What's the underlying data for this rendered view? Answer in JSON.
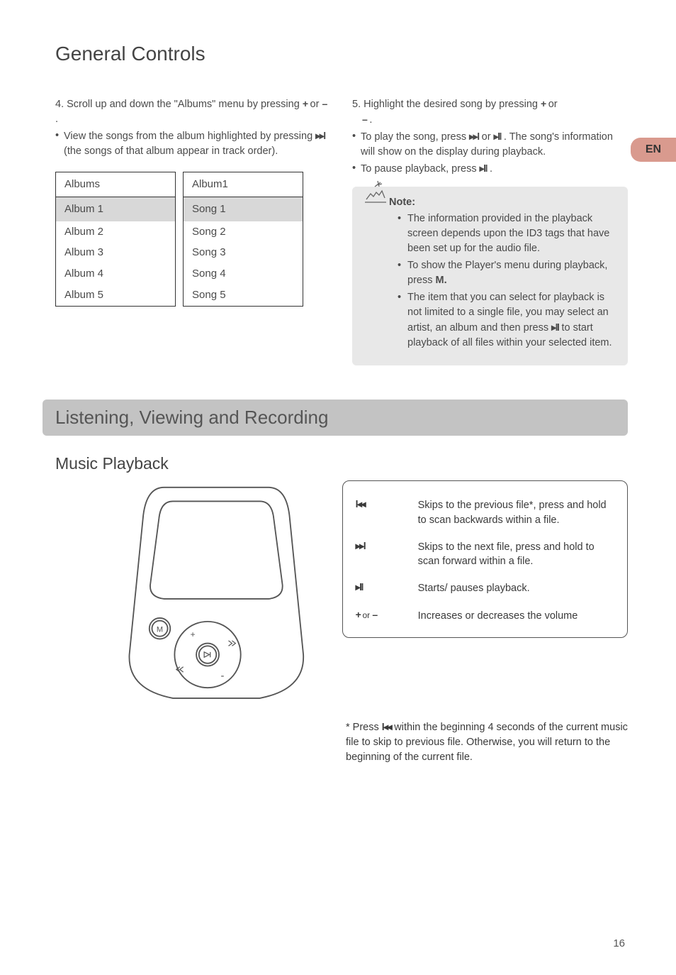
{
  "lang_tab": "EN",
  "title": "General Controls",
  "left": {
    "step4_a": "4. Scroll up and down the \"Albums\" menu by pressing ",
    "step4_b": " or ",
    "step4_c": " .",
    "bullet_a": "View the songs from the album highlighted by pressing ",
    "bullet_b": " (the songs of that album appear in track order).",
    "table1_head": "Albums",
    "table1_rows": [
      "Album 1",
      "Album 2",
      "Album 3",
      "Album 4",
      "Album 5"
    ],
    "table2_head": "Album1",
    "table2_rows": [
      "Song 1",
      "Song 2",
      "Song 3",
      "Song 4",
      "Song 5"
    ]
  },
  "right": {
    "step5_a": "5. Highlight the desired song by pressing ",
    "step5_b": " or ",
    "step5_c": " .",
    "b1_a": "To play the song, press ",
    "b1_b": " or ",
    "b1_c": " . The song's information will show on the display during playback.",
    "b2_a": "To pause playback, press ",
    "b2_b": " ."
  },
  "note": {
    "title": "Note:",
    "i1": "The information provided in the playback screen depends upon the ID3 tags that have been set up for the audio file.",
    "i2_a": "To show the Player's menu during playback, press ",
    "i2_b": "M.",
    "i3_a": "The item that you can select for playback is not limited to a single file, you may select an artist, an album and then press ",
    "i3_b": " to start playback of all files within your selected item."
  },
  "section2": "Listening, Viewing and Recording",
  "subhead": "Music Playback",
  "controls": {
    "r1": "Skips to the previous file*, press and hold to scan backwards within a file.",
    "r2": "Skips to the next file, press and hold to scan forward within a file.",
    "r3": "Starts/ pauses playback.",
    "r4_or": "or",
    "r4": "Increases or decreases the volume"
  },
  "footnote_a": "* Press ",
  "footnote_b": " within the beginning 4 seconds of the current music file to skip to previous file. Otherwise, you will return to the beginning of the current file.",
  "icons": {
    "plus": "+",
    "minus": "–",
    "next": "▸▸l",
    "prev": "l◂◂",
    "playpause": "▸ll"
  },
  "page": "16"
}
